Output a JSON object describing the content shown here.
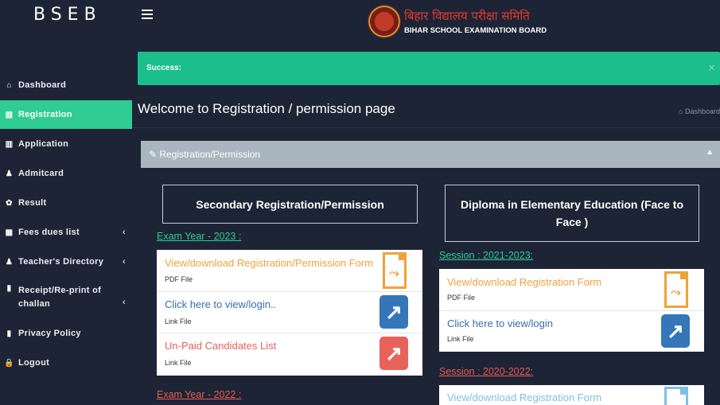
{
  "header": {
    "logo": "BSEB",
    "brand_hindi": "बिहार विद्यालय परीक्षा समिति",
    "brand_english": "BIHAR SCHOOL EXAMINATION BOARD"
  },
  "sidebar": {
    "items": [
      {
        "label": "Dashboard",
        "icon": "home-icon"
      },
      {
        "label": "Registration",
        "icon": "bar-chart-icon",
        "active": true
      },
      {
        "label": "Application",
        "icon": "bar-chart-icon"
      },
      {
        "label": "Admitcard",
        "icon": "users-icon"
      },
      {
        "label": "Result",
        "icon": "paw-icon"
      },
      {
        "label": "Fees dues list",
        "icon": "grid-icon",
        "expandable": true
      },
      {
        "label": "Teacher's Directory",
        "icon": "users-icon",
        "expandable": true
      },
      {
        "label": "Receipt/Re-print of challan",
        "icon": "book-icon",
        "expandable": true
      },
      {
        "label": "Privacy Policy",
        "icon": "book-icon"
      },
      {
        "label": "Logout",
        "icon": "lock-icon"
      }
    ]
  },
  "alert": {
    "text": "Success:",
    "close": "×"
  },
  "page": {
    "title": "Welcome to Registration / permission page",
    "breadcrumb": "Dashboard"
  },
  "panel": {
    "title": "Registration/Permission",
    "left": {
      "heading": "Secondary Registration/Permission",
      "year1": "Exam Year - 2023 :",
      "rows": [
        {
          "title": "View/download Registration/Permission Form",
          "sub": "PDF File",
          "icon": "pdf-icon"
        },
        {
          "title": "Click here to view/login..",
          "sub": "Link File",
          "icon": "external-link-icon"
        },
        {
          "title": "Un-Paid Candidates List",
          "sub": "Link File",
          "icon": "external-link-icon"
        }
      ],
      "year2": "Exam Year - 2022 :"
    },
    "right": {
      "heading": "Diploma in Elementary Education (Face to Face )",
      "session1": "Session : 2021-2023:",
      "rows": [
        {
          "title": "View/download Registration Form",
          "sub": "PDF File",
          "icon": "pdf-icon"
        },
        {
          "title": "Click here to view/login",
          "sub": "Link File",
          "icon": "external-link-icon"
        }
      ],
      "session2": "Session : 2020-2022:",
      "row3": {
        "title": "View/download Registration Form",
        "icon": "pdf-icon"
      }
    }
  },
  "colors": {
    "background": "#1c2436",
    "accent_green": "#2fcc94",
    "alert_green": "#1cbf8b",
    "panel_header": "#a9b5bf",
    "orange": "#f0a23a",
    "link_blue": "#3576b9",
    "red": "#e8625c"
  }
}
